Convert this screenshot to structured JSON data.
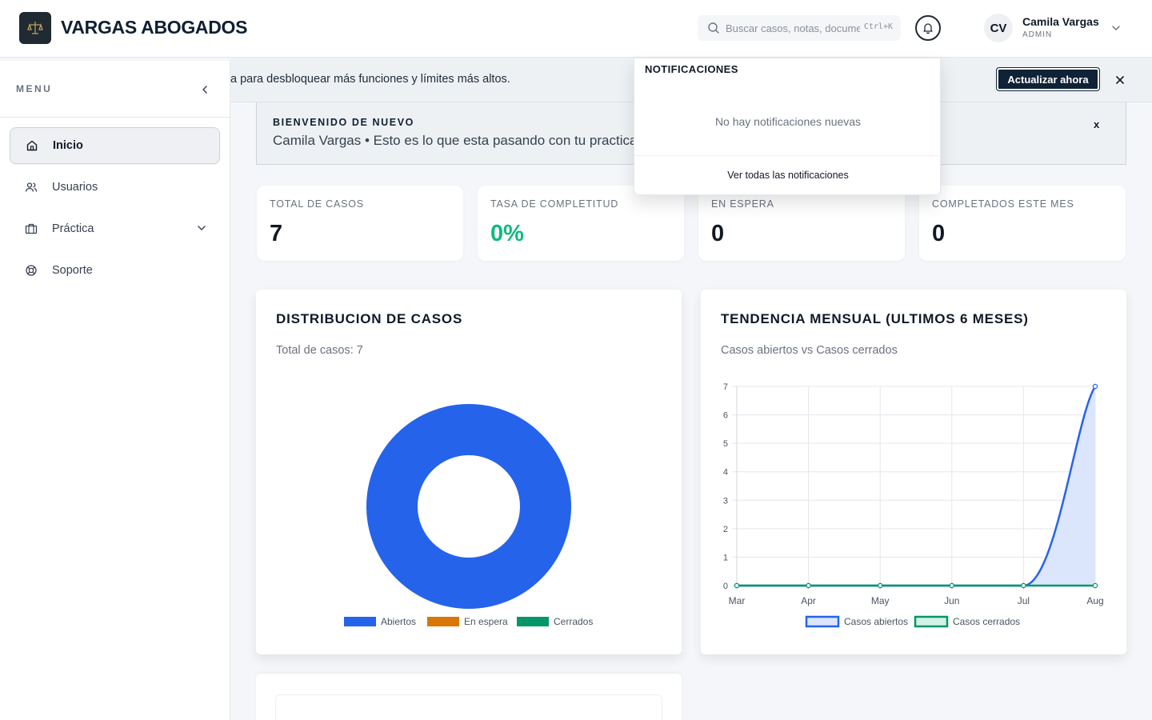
{
  "header": {
    "brand": "VARGAS ABOGADOS",
    "search_placeholder": "Buscar casos, notas, documentos...",
    "search_shortcut": "Ctrl+K",
    "user": {
      "initials": "CV",
      "name": "Camila Vargas",
      "role": "ADMIN"
    }
  },
  "sidebar": {
    "title": "MENU",
    "items": [
      {
        "label": "Inicio",
        "icon": "home-icon",
        "active": true
      },
      {
        "label": "Usuarios",
        "icon": "users-icon"
      },
      {
        "label": "Práctica",
        "icon": "briefcase-icon",
        "expandable": true
      },
      {
        "label": "Soporte",
        "icon": "lifebuoy-icon"
      }
    ]
  },
  "banner": {
    "text": "a para desbloquear más funciones y límites más altos.",
    "button": "Actualizar ahora"
  },
  "welcome": {
    "kicker": "BIENVENIDO DE NUEVO",
    "subtitle": "Camila Vargas • Esto es lo que esta pasando con tu practica hoy.",
    "close": "x"
  },
  "stats": [
    {
      "label": "TOTAL DE CASOS",
      "value": "7"
    },
    {
      "label": "TASA DE COMPLETITUD",
      "value": "0%",
      "color": "#10b981"
    },
    {
      "label": "EN ESPERA",
      "value": "0"
    },
    {
      "label": "COMPLETADOS ESTE MES",
      "value": "0"
    }
  ],
  "distribution": {
    "title": "DISTRIBUCION DE CASOS",
    "subtitle": "Total de casos: 7"
  },
  "trend": {
    "title": "TENDENCIA MENSUAL (ULTIMOS 6 MESES)",
    "subtitle": "Casos abiertos vs Casos cerrados"
  },
  "notifications": {
    "title": "NOTIFICACIONES",
    "empty": "No hay notificaciones nuevas",
    "view_all": "Ver todas las notificaciones"
  },
  "chart_data": [
    {
      "type": "pie",
      "categories": [
        "Abiertos",
        "En espera",
        "Cerrados"
      ],
      "values": [
        7,
        0,
        0
      ],
      "colors": [
        "#2563eb",
        "#d97706",
        "#059669"
      ],
      "legend": "bottom",
      "donut": true
    },
    {
      "type": "area",
      "categories": [
        "Mar",
        "Apr",
        "May",
        "Jun",
        "Jul",
        "Aug"
      ],
      "series": [
        {
          "name": "Casos abiertos",
          "values": [
            0,
            0,
            0,
            0,
            0,
            7
          ],
          "color": "#2563eb",
          "fill": "#dbe5fb"
        },
        {
          "name": "Casos cerrados",
          "values": [
            0,
            0,
            0,
            0,
            0,
            0
          ],
          "color": "#059669",
          "fill": "#d1f2e5"
        }
      ],
      "ylim": [
        0,
        7
      ],
      "yticks": [
        0,
        1,
        2,
        3,
        4,
        5,
        6,
        7
      ],
      "grid": true,
      "legend": "bottom"
    }
  ]
}
